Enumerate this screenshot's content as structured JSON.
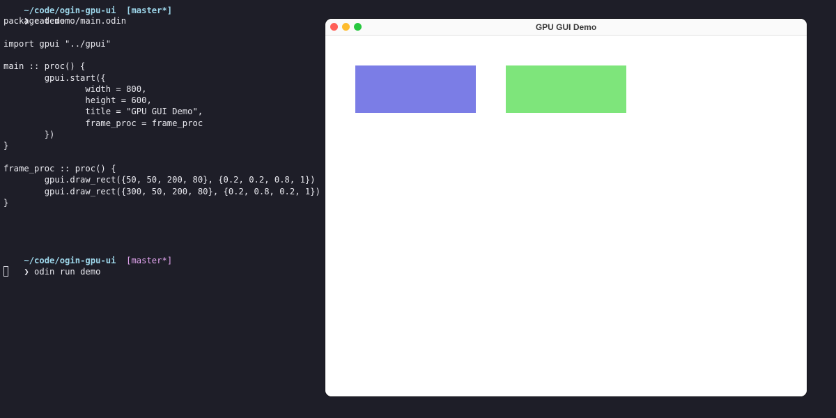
{
  "terminal": {
    "top_partial_prompt": "~/code/ogin-gpu-ui  [master*]",
    "command_1_glyph": "❯",
    "command_1": "cat demo/main.odin",
    "code_lines": [
      "package demo",
      "",
      "import gpui \"../gpui\"",
      "",
      "main :: proc() {",
      "        gpui.start({",
      "                width = 800,",
      "                height = 600,",
      "                title = \"GPU GUI Demo\",",
      "                frame_proc = frame_proc",
      "        })",
      "}",
      "",
      "frame_proc :: proc() {",
      "        gpui.draw_rect({50, 50, 200, 80}, {0.2, 0.2, 0.8, 1})",
      "        gpui.draw_rect({300, 50, 200, 80}, {0.2, 0.8, 0.2, 1})",
      "}"
    ],
    "prompt_path": "~/code/ogin-gpu-ui",
    "prompt_branch": "[master*]",
    "command_2_glyph": "❯",
    "command_2": "odin run demo"
  },
  "app_window": {
    "title": "GPU GUI Demo",
    "traffic_lights": {
      "close": "#ff5f57",
      "minimize": "#febc2e",
      "zoom": "#28c840"
    },
    "rects": [
      {
        "name": "blue-rect",
        "color": "#7b7de6"
      },
      {
        "name": "green-rect",
        "color": "#7ee57b"
      }
    ]
  }
}
